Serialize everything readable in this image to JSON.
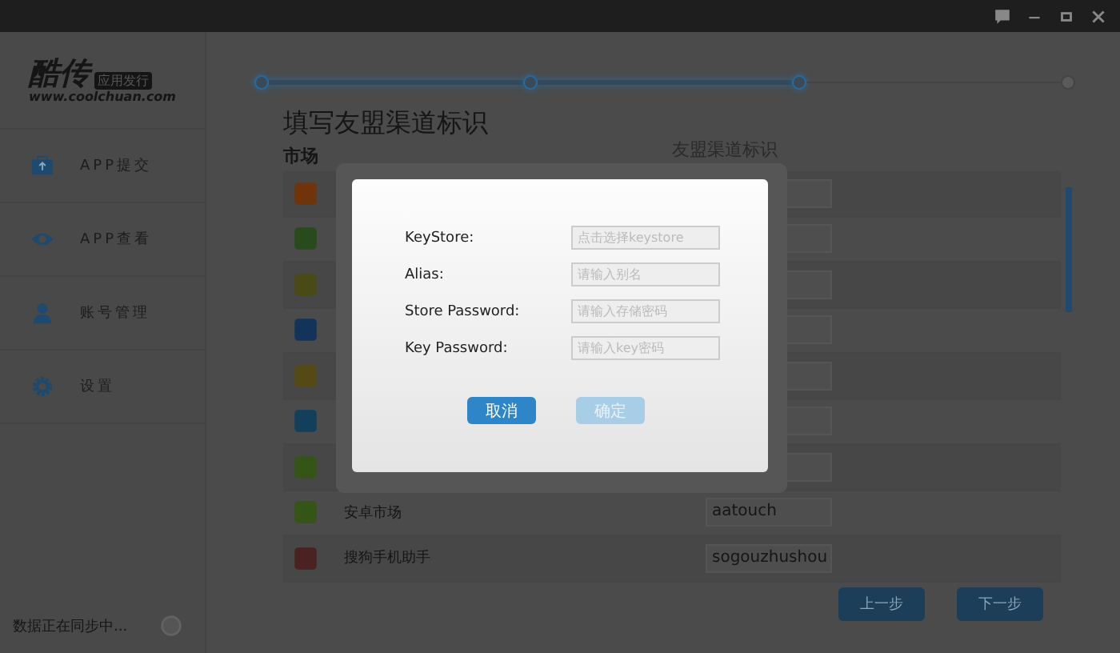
{
  "logo": {
    "name": "酷传",
    "badge": "应用发行",
    "url": "www.coolchuan.com"
  },
  "steps": [
    {
      "done": true
    },
    {
      "done": true
    },
    {
      "done": true
    },
    {
      "done": false
    }
  ],
  "sidebar": {
    "items": [
      {
        "label": "APP提交",
        "kind": "upload",
        "selected": false
      },
      {
        "label": "APP查看",
        "kind": "eye",
        "selected": false
      },
      {
        "label": "账号管理",
        "kind": "user",
        "selected": false
      },
      {
        "label": "设置",
        "kind": "gear",
        "selected": false
      }
    ],
    "status": "数据正在同步中..."
  },
  "page": {
    "title": "填写友盟渠道标识",
    "columns": [
      "市场",
      "友盟渠道标识"
    ],
    "rows": [
      {
        "color": "#70340b"
      },
      {
        "color": "#294a1d"
      },
      {
        "color": "#4a4a16"
      },
      {
        "color": "#12345a"
      },
      {
        "color": "#554a16"
      },
      {
        "color": "#12405a"
      },
      {
        "color": "#345516"
      },
      {
        "color": "#345516",
        "market": "安卓市场",
        "channel": "aatouch"
      },
      {
        "color": "#4a2222",
        "market": "搜狗手机助手",
        "channel": "sogouzhushou"
      }
    ],
    "buttons": [
      "上一步",
      "下一步"
    ]
  },
  "dialog": {
    "fields": [
      {
        "label": "KeyStore:",
        "placeholder": "点击选择keystore"
      },
      {
        "label": "Alias:",
        "placeholder": "请输入别名"
      },
      {
        "label": "Store Password:",
        "placeholder": "请输入存储密码"
      },
      {
        "label": "Key Password:",
        "placeholder": "请输入key密码"
      }
    ],
    "buttons": [
      {
        "label": "取消",
        "disabled": false
      },
      {
        "label": "确定",
        "disabled": true
      }
    ]
  }
}
